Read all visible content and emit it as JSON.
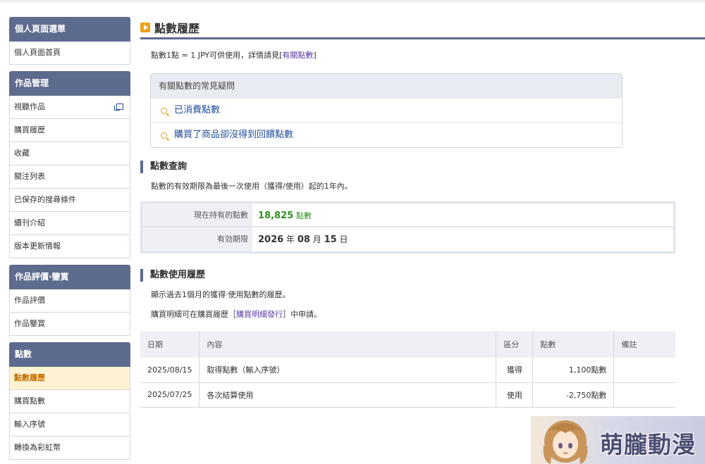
{
  "sidebar": {
    "groups": [
      {
        "title": "個人頁面選單",
        "items": [
          "個人頁面首頁"
        ]
      },
      {
        "title": "作品管理",
        "items": [
          "視聽作品",
          "購買履歷",
          "收藏",
          "關注列表",
          "已保存的搜尋條件",
          "續刊介紹",
          "版本更新情報"
        ]
      },
      {
        "title": "作品評價·鑒賞",
        "items": [
          "作品評價",
          "作品鑒賞"
        ]
      },
      {
        "title": "點數",
        "items": [
          "點數履歷",
          "購買點數",
          "輸入序號",
          "轉換為彩虹幣"
        ]
      }
    ]
  },
  "main": {
    "title": "點數履歷",
    "rate_note_prefix": "點數1點 = 1 JPY可供使用，詳情請見[",
    "rate_note_link": "有關點數",
    "rate_note_suffix": "]",
    "faq": {
      "title": "有關點數的常見疑問",
      "items": [
        "已消費點數",
        "購買了商品卻沒得到回饋點數"
      ]
    },
    "query": {
      "title": "點數查詢",
      "note": "點數的有效期限為最後一次使用（獲得/使用）起的1年內。",
      "current_label": "現在持有的點數",
      "current_value": "18,825",
      "current_unit": "點數",
      "expiry_label": "有効期限",
      "expiry_year": "2026",
      "expiry_year_unit": "年",
      "expiry_month": "08",
      "expiry_month_unit": "月",
      "expiry_day": "15",
      "expiry_day_unit": "日"
    },
    "history": {
      "title": "點數使用履歷",
      "note1": "顯示過去1個月的獲得·使用點數的履歷。",
      "note2_prefix": "購買明細可在購買履歷［",
      "note2_link": "購買明細發行",
      "note2_suffix": "］中申請。",
      "columns": [
        "日期",
        "內容",
        "區分",
        "點數",
        "備註"
      ],
      "rows": [
        {
          "date": "2025/08/15",
          "content": "取得點數（輸入序號）",
          "type": "獲得",
          "points": "1,100點數",
          "remark": ""
        },
        {
          "date": "2025/07/25",
          "content": "各次結算使用",
          "type": "使用",
          "points": "-2,750點數",
          "remark": ""
        }
      ]
    }
  },
  "watermark": {
    "text": "萌朧動漫"
  },
  "colors": {
    "header": "#5d6b8e",
    "active_bg": "#fdf3d2",
    "active_text": "#c86e00",
    "link": "#1f4d9b",
    "points_green": "#2f8f1f"
  }
}
